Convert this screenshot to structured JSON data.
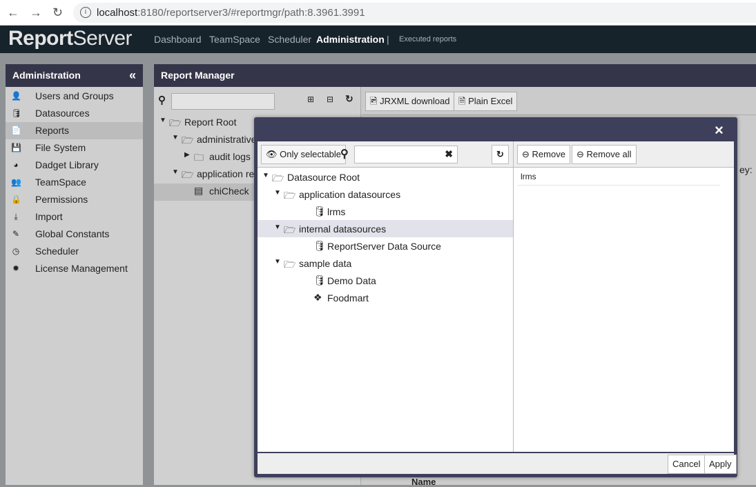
{
  "browser": {
    "url_host": "localhost",
    "url_rest": ":8180/reportserver3/#reportmgr/path:8.3961.3991"
  },
  "app": {
    "logo_bold": "Report",
    "logo_light": "Server",
    "nav": [
      "Dashboard",
      "TeamSpace",
      "Scheduler",
      "Administration"
    ],
    "nav_active": "Administration",
    "separator": "|",
    "executed": "Executed reports"
  },
  "sidebar": {
    "title": "Administration",
    "collapse": "«",
    "selected": "Reports",
    "items": [
      {
        "label": "Users and Groups",
        "icon": "user-icon",
        "glyph": "👤"
      },
      {
        "label": "Datasources",
        "icon": "database-icon",
        "glyph": "🛢"
      },
      {
        "label": "Reports",
        "icon": "file-icon",
        "glyph": "📄"
      },
      {
        "label": "File System",
        "icon": "floppy-icon",
        "glyph": "💾"
      },
      {
        "label": "Dadget Library",
        "icon": "dashboard-icon",
        "glyph": "◕"
      },
      {
        "label": "TeamSpace",
        "icon": "users-icon",
        "glyph": "👥"
      },
      {
        "label": "Permissions",
        "icon": "lock-icon",
        "glyph": "🔒"
      },
      {
        "label": "Import",
        "icon": "download-icon",
        "glyph": "⤓"
      },
      {
        "label": "Global Constants",
        "icon": "edit-icon",
        "glyph": "✎"
      },
      {
        "label": "Scheduler",
        "icon": "clock-icon",
        "glyph": "◷"
      },
      {
        "label": "License Management",
        "icon": "certificate-icon",
        "glyph": "✹"
      }
    ]
  },
  "main": {
    "title": "Report Manager",
    "toolbar": {
      "jrxml": "JRXML download",
      "excel": "Plain Excel"
    },
    "tree": [
      {
        "label": "Report Root",
        "depth": 0,
        "type": "folder-open"
      },
      {
        "label": "administrative",
        "depth": 1,
        "type": "folder-open"
      },
      {
        "label": "audit logs",
        "depth": 2,
        "type": "folder"
      },
      {
        "label": "application rep",
        "depth": 1,
        "type": "folder-open"
      },
      {
        "label": "chiCheck",
        "depth": 2,
        "type": "report",
        "selected": true
      }
    ],
    "partial_key": "ey:",
    "column_name": "Name"
  },
  "modal": {
    "close": "×",
    "only_selectable": "Only selectable",
    "search_value": "",
    "remove": "Remove",
    "remove_all": "Remove all",
    "tree": [
      {
        "label": "Datasource Root",
        "depth": 0,
        "type": "folder-open"
      },
      {
        "label": "application datasources",
        "depth": 1,
        "type": "folder-open"
      },
      {
        "label": "lrms",
        "depth": 2,
        "type": "database"
      },
      {
        "label": "internal datasources",
        "depth": 1,
        "type": "folder-open",
        "selected": true
      },
      {
        "label": "ReportServer Data Source",
        "depth": 2,
        "type": "database"
      },
      {
        "label": "sample data",
        "depth": 1,
        "type": "folder-open"
      },
      {
        "label": "Demo Data",
        "depth": 2,
        "type": "database"
      },
      {
        "label": "Foodmart",
        "depth": 2,
        "type": "cubes"
      }
    ],
    "selected_items": [
      "lrms"
    ],
    "cancel": "Cancel",
    "apply": "Apply"
  }
}
